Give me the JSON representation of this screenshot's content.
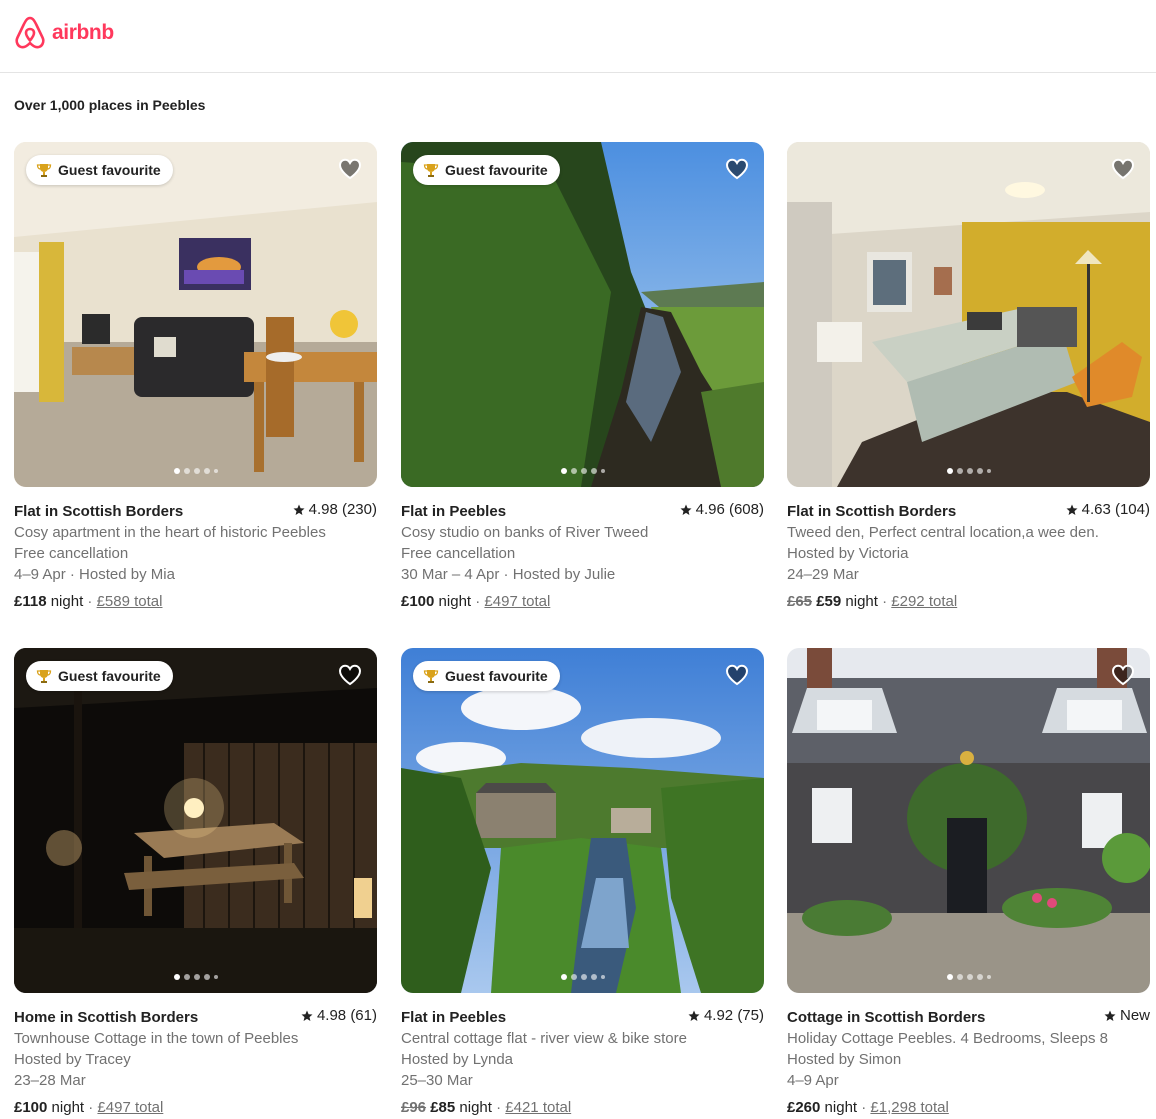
{
  "header": {
    "logo_text": "airbnb"
  },
  "results_label": "Over 1,000 places in Peebles",
  "listings": [
    {
      "badge": "Guest favourite",
      "type": "Flat in Scottish Borders",
      "rating": "4.98 (230)",
      "desc": "Cosy apartment in the heart of historic Peebles",
      "line3": "Free cancellation",
      "line4": "4–9 Apr · Hosted by Mia",
      "orig_price": "",
      "price": "£118",
      "night": "night",
      "sep": "·",
      "total": "£589 total"
    },
    {
      "badge": "Guest favourite",
      "type": "Flat in Peebles",
      "rating": "4.96 (608)",
      "desc": "Cosy studio on banks of River Tweed",
      "line3": "Free cancellation",
      "line4": "30 Mar – 4 Apr · Hosted by Julie",
      "orig_price": "",
      "price": "£100",
      "night": "night",
      "sep": "·",
      "total": "£497 total"
    },
    {
      "badge": "",
      "type": "Flat in Scottish Borders",
      "rating": "4.63 (104)",
      "desc": "Tweed den, Perfect central location,a wee den.",
      "line3": "Hosted by Victoria",
      "line4": "24–29 Mar",
      "orig_price": "£65",
      "price": "£59",
      "night": "night",
      "sep": "·",
      "total": "£292 total"
    },
    {
      "badge": "Guest favourite",
      "type": "Home in Scottish Borders",
      "rating": "4.98 (61)",
      "desc": "Townhouse Cottage in the town of Peebles",
      "line3": "Hosted by Tracey",
      "line4": "23–28 Mar",
      "orig_price": "",
      "price": "£100",
      "night": "night",
      "sep": "·",
      "total": "£497 total"
    },
    {
      "badge": "Guest favourite",
      "type": "Flat in Peebles",
      "rating": "4.92 (75)",
      "desc": "Central cottage flat - river view & bike store",
      "line3": "Hosted by Lynda",
      "line4": "25–30 Mar",
      "orig_price": "£96",
      "price": "£85",
      "night": "night",
      "sep": "·",
      "total": "£421 total"
    },
    {
      "badge": "",
      "type": "Cottage in Scottish Borders",
      "rating": "New",
      "desc": "Holiday Cottage Peebles. 4 Bedrooms, Sleeps 8",
      "line3": "Hosted by Simon",
      "line4": "4–9 Apr",
      "orig_price": "",
      "price": "£260",
      "night": "night",
      "sep": "·",
      "total": "£1,298 total"
    }
  ],
  "colors": {
    "brand": "#ff385c",
    "text": "#222222",
    "muted": "#717171"
  },
  "icons": [
    "airbnb-logo-icon",
    "trophy-icon",
    "heart-icon",
    "star-icon"
  ]
}
